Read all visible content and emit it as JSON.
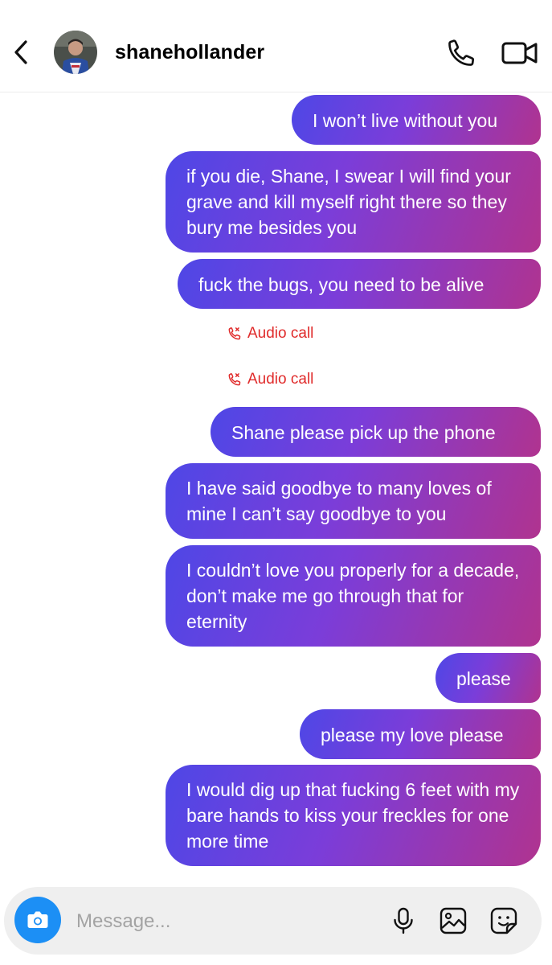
{
  "header": {
    "username": "shanehollander",
    "icons": {
      "back": "chevron-left-icon",
      "call": "phone-icon",
      "video": "video-camera-icon"
    }
  },
  "messages": [
    {
      "type": "sent",
      "text": "I won’t live without you"
    },
    {
      "type": "sent",
      "text": "if you die, Shane, I swear I will find your grave and kill myself right there so they bury me besides you"
    },
    {
      "type": "sent",
      "text": "fuck the bugs, you need to be alive"
    },
    {
      "type": "call",
      "text": "Audio call"
    },
    {
      "type": "call",
      "text": "Audio call"
    },
    {
      "type": "sent",
      "text": "Shane please pick up the phone"
    },
    {
      "type": "sent",
      "text": "I have said goodbye to many loves of mine I can’t say goodbye to you"
    },
    {
      "type": "sent",
      "text": "I couldn’t love you properly for a decade, don’t make me go through that for eternity"
    },
    {
      "type": "sent",
      "text": "please"
    },
    {
      "type": "sent",
      "text": "please my love please"
    },
    {
      "type": "sent",
      "text": "I would dig up that fucking 6 feet with my bare hands to kiss your freckles for one more time"
    }
  ],
  "composer": {
    "placeholder": "Message...",
    "icons": {
      "camera": "camera-icon",
      "mic": "microphone-icon",
      "gallery": "image-icon",
      "sticker": "sticker-icon"
    }
  },
  "colors": {
    "bubble_gradient_start": "#4e47e6",
    "bubble_gradient_mid": "#7b3dd9",
    "bubble_gradient_end": "#b0338f",
    "missed_call": "#e02b2b",
    "camera_button": "#1c8ff5",
    "composer_bg": "#efefef"
  }
}
